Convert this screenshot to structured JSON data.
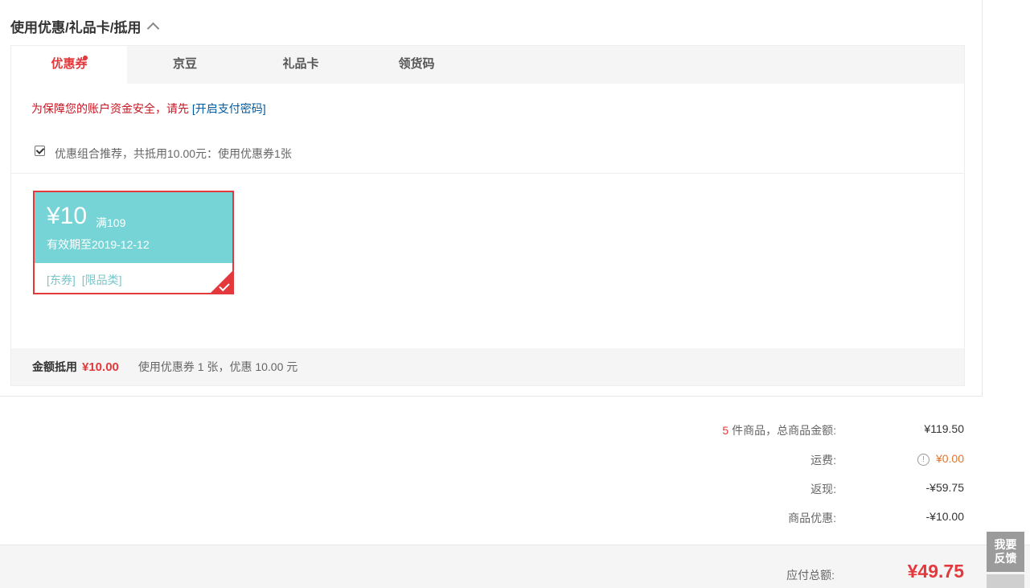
{
  "section": {
    "title": "使用优惠/礼品卡/抵用"
  },
  "tabs": [
    {
      "label": "优惠券",
      "active": true,
      "has_dot": true
    },
    {
      "label": "京豆"
    },
    {
      "label": "礼品卡"
    },
    {
      "label": "领货码"
    }
  ],
  "notice": {
    "text": "为保障您的账户资金安全，请先",
    "link": "[开启支付密码]"
  },
  "combo": {
    "checked": true,
    "text": "优惠组合推荐，共抵用10.00元：使用优惠券1张"
  },
  "coupon": {
    "amount": "¥10",
    "condition": "满109",
    "validity": "有效期至2019-12-12",
    "tags": [
      "[东券]",
      "[限品类]"
    ],
    "selected": true
  },
  "summary": {
    "label": "金额抵用",
    "value": "¥10.00",
    "desc": "使用优惠券 1 张，优惠 10.00 元"
  },
  "totals": {
    "count": "5",
    "goods_label": "件商品，总商品金额:",
    "goods_value": "¥119.50",
    "shipping_label": "运费:",
    "shipping_value": "¥0.00",
    "cashback_label": "返现:",
    "cashback_value": "-¥59.75",
    "discount_label": "商品优惠:",
    "discount_value": "-¥10.00"
  },
  "payable": {
    "label": "应付总额:",
    "value": "¥49.75"
  },
  "feedback": {
    "line1": "我要",
    "line2": "反馈"
  },
  "colors": {
    "accent": "#e4393c",
    "coupon_bg": "#76d3d6",
    "link": "#005aa0",
    "orange": "#e4742c"
  }
}
